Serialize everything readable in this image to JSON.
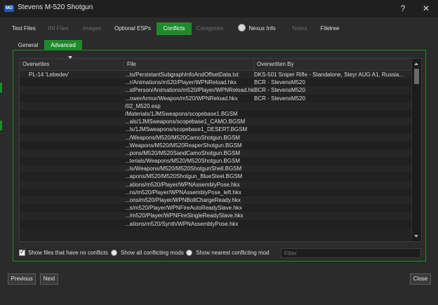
{
  "window": {
    "app_icon": "MO",
    "title": "Stevens M-520 Shotgun",
    "help_label": "?",
    "close_label": "✕"
  },
  "tabs": [
    {
      "label": "Text Files",
      "state": "normal"
    },
    {
      "label": "INI Files",
      "state": "disabled"
    },
    {
      "label": "Images",
      "state": "disabled"
    },
    {
      "label": "Optional ESPs",
      "state": "normal"
    },
    {
      "label": "Conflicts",
      "state": "active"
    },
    {
      "label": "Categories",
      "state": "disabled"
    },
    {
      "label": "Nexus Info",
      "state": "normal",
      "icon": "globe-icon"
    },
    {
      "label": "Notes",
      "state": "disabled"
    },
    {
      "label": "Filetree",
      "state": "normal"
    }
  ],
  "subtabs": [
    {
      "label": "General",
      "state": "normal"
    },
    {
      "label": "Advanced",
      "state": "active"
    }
  ],
  "table": {
    "columns": [
      "Overwrites",
      "File",
      "Overwritten By"
    ],
    "rows": [
      [
        "PL-14 'Lebedev'",
        "...ts/PersistantSubgraphInfoAndOffsetData.txt",
        "DKS-501 Sniper Rifle - Standalone, Steyr AUG A1, Russia..."
      ],
      [
        "",
        "...r/Animations/m520/Player/WPNReload.hkx",
        "BCR - StevensM520"
      ],
      [
        "",
        "...stPerson/Animations/m520/Player/WPNReload.hkx",
        "BCR - StevensM520"
      ],
      [
        "",
        "...owerArmor/Weapon/m520/WPNReload.hkx",
        "BCR - StevensM520"
      ],
      [
        "",
        "/02_M520.esp",
        ""
      ],
      [
        "",
        "/Materials/1JMSweapons/scopebase1.BGSM",
        ""
      ],
      [
        "",
        "...als/1JMSweapons/scopebase1_CAMO.BGSM",
        ""
      ],
      [
        "",
        "...ls/1JMSweapons/scopebase1_DESERT.BGSM",
        ""
      ],
      [
        "",
        ".../Weapons/M520/M520CamoShotgun.BGSM",
        ""
      ],
      [
        "",
        "...Weapons/M520/M520ReaperShotgun.BGSM",
        ""
      ],
      [
        "",
        "...pons/M520/M520SandCamoShotgun.BGSM",
        ""
      ],
      [
        "",
        "...terials/Weapons/M520/M520Shotgun.BGSM",
        ""
      ],
      [
        "",
        "...ls/Weapons/M520/M520ShotgunShell.BGSM",
        ""
      ],
      [
        "",
        "...apons/M520/M520Shotgun_BlueSteel.BGSM",
        ""
      ],
      [
        "",
        "...ations/m520/Player/WPNAssemblyPose.hkx",
        ""
      ],
      [
        "",
        "...ns/m520/Player/WPNAssemblyPose_left.hkx",
        ""
      ],
      [
        "",
        "...ons/m520/Player/WPNBoltChargeReady.hkx",
        ""
      ],
      [
        "",
        "...s/m520/Player/WPNFireAutoReadySlave.hkx",
        ""
      ],
      [
        "",
        ".../m520/Player/WPNFireSingleReadySlave.hkx",
        ""
      ],
      [
        "",
        "...ations/m520/Synth/WPNAssemblyPose.hkx",
        ""
      ]
    ]
  },
  "options": {
    "show_no_conflicts_label": "Show files that have no conflicts",
    "show_no_conflicts_checked": true,
    "show_all_label": "Show all conflicting mods",
    "show_nearest_label": "Show nearest conflicting mod",
    "filter_placeholder": "Filter"
  },
  "buttons": {
    "previous": "Previous",
    "next": "Next",
    "close": "Close"
  },
  "colors": {
    "accent": "#1e8a2c",
    "background": "#2b2b2b",
    "titlebar": "#1f1f1f"
  }
}
